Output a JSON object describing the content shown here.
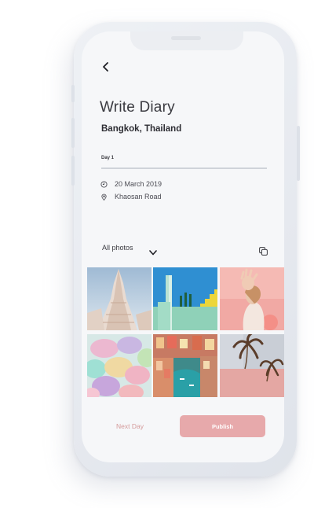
{
  "header": {
    "title": "Write Diary",
    "location": "Bangkok, Thailand"
  },
  "entry": {
    "day_label": "Day 1",
    "date": "20 March 2019",
    "place": "Khaosan Road"
  },
  "photos": {
    "filter_label": "All photos",
    "items": [
      {
        "subject": "temple"
      },
      {
        "subject": "teal-building"
      },
      {
        "subject": "woman-hand"
      },
      {
        "subject": "macarons"
      },
      {
        "subject": "coastal-village"
      },
      {
        "subject": "pink-wall-palms"
      }
    ]
  },
  "footer": {
    "next_label": "Next Day",
    "publish_label": "Publish"
  },
  "icons": {
    "back": "chevron-left-icon",
    "clock": "clock-icon",
    "location": "location-pin-icon",
    "dropdown": "chevron-down-icon",
    "select_multiple": "multi-select-icon"
  },
  "colors": {
    "accent": "#e7a9ab",
    "next_text": "#d49a9a",
    "screen_bg": "#f6f7f9",
    "text": "#2d2d33"
  }
}
